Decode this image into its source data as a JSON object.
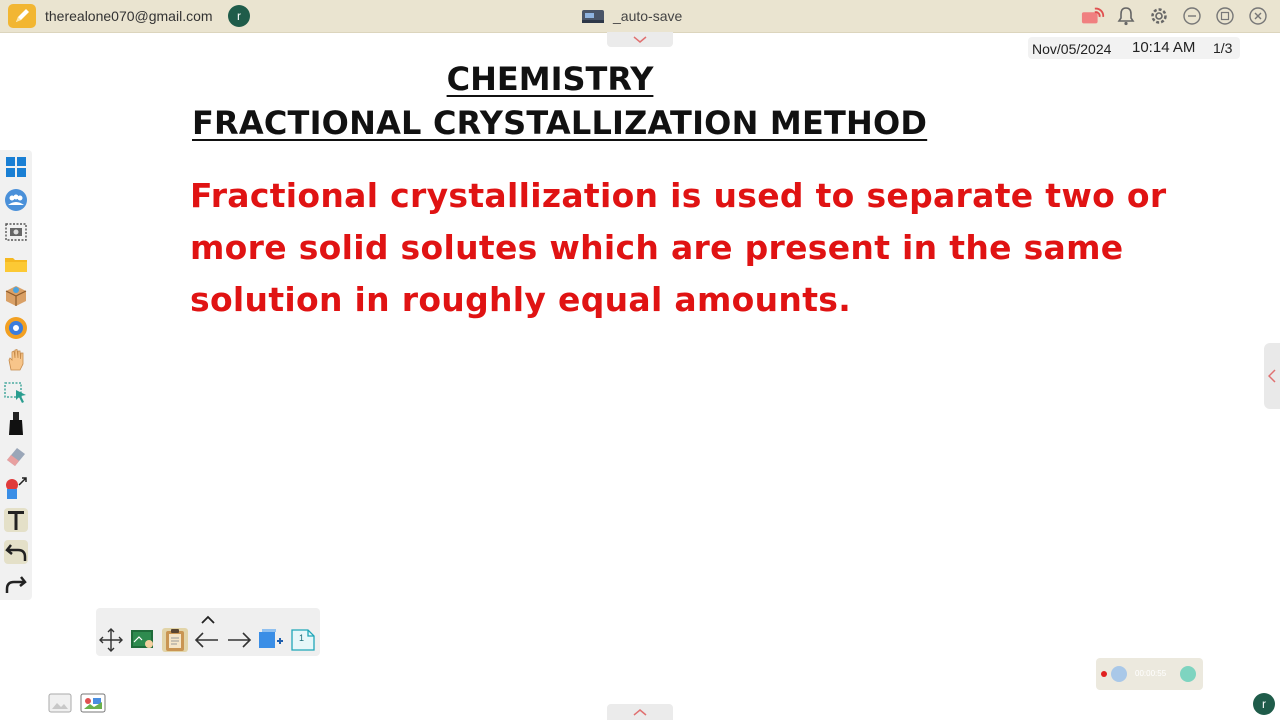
{
  "topbar": {
    "account_email": "therealone070@gmail.com",
    "avatar_letter": "r",
    "file_name": "_auto-save"
  },
  "datebar": {
    "date": "Nov/05/2024",
    "time": "10:14 AM",
    "page": "1/3"
  },
  "slide": {
    "title": "CHEMISTRY",
    "subtitle": "FRACTIONAL CRYSTALLIZATION METHOD",
    "body": "Fractional crystallization is used to separate two or more solid solutes which are present in the same solution in roughly equal amounts."
  },
  "page_toolbar": {
    "page_number": "1"
  },
  "recording": {
    "elapsed": "00:00:55"
  },
  "colors": {
    "topbar_bg": "#eae4d0",
    "body_text": "#e01313",
    "heading": "#111111",
    "avatar": "#1f5c4a"
  },
  "icons": {
    "left_toolbar": [
      "windows-icon",
      "people-icon",
      "screen-capture-icon",
      "folder-icon",
      "package-icon",
      "browser-icon",
      "hand-icon",
      "select-icon",
      "pen-icon",
      "eraser-icon",
      "shapes-icon",
      "text-icon",
      "undo-icon",
      "redo-icon"
    ],
    "top_right": [
      "cast-icon",
      "bell-icon",
      "gear-icon",
      "minimize-icon",
      "restore-icon",
      "close-icon"
    ]
  }
}
